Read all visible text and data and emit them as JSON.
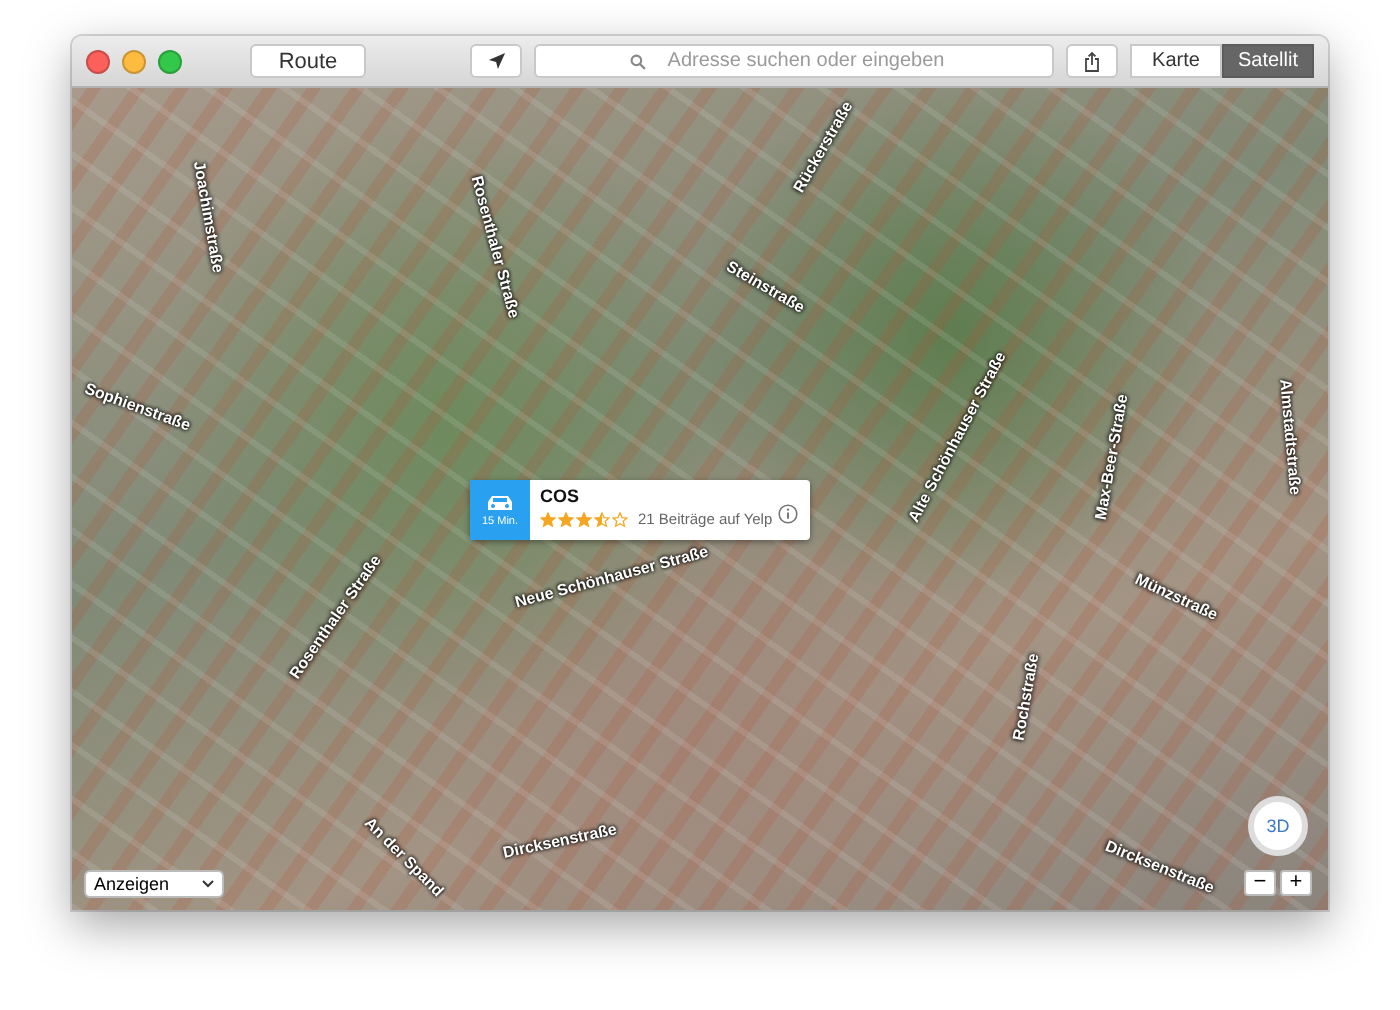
{
  "toolbar": {
    "route_button": "Route",
    "search": {
      "placeholder": "Adresse suchen oder eingeben"
    },
    "map_types": [
      {
        "label": "Karte",
        "selected": false
      },
      {
        "label": "Satellit",
        "selected": true
      }
    ]
  },
  "street_labels": [
    "Joachimstraße",
    "Rosenthaler Straße",
    "Rückerstraße",
    "Steinstraße",
    "Sophienstraße",
    "Alte Schönhauser Straße",
    "Max-Beer-Straße",
    "Almstadtstraße",
    "Neue Schönhauser Straße",
    "Rosenthaler Straße",
    "Münzstraße",
    "Rochstraße",
    "Dircksenstraße",
    "Dircksenstraße",
    "An der Spand"
  ],
  "callout": {
    "travel_time": "15 Min.",
    "title": "COS",
    "stars": 3.5,
    "reviews": "21 Beiträge auf Yelp"
  },
  "display_menu": {
    "value": "Anzeigen"
  },
  "compass": {
    "label": "3D"
  },
  "zoom_buttons": [
    "−",
    "+"
  ]
}
